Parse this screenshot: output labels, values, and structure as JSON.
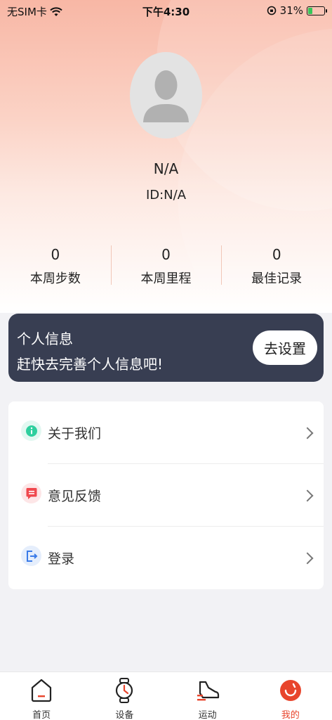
{
  "status_bar": {
    "carrier": "无SIM卡",
    "time": "下午4:30",
    "battery": "31%",
    "battery_level": 0.31
  },
  "profile": {
    "name": "N/A",
    "id": "ID:N/A"
  },
  "stats": [
    {
      "value": "0",
      "label": "本周步数"
    },
    {
      "value": "0",
      "label": "本周里程"
    },
    {
      "value": "0",
      "label": "最佳记录"
    }
  ],
  "promo": {
    "title": "个人信息",
    "subtitle": "赶快去完善个人信息吧!",
    "button": "去设置"
  },
  "menu": [
    {
      "label": "关于我们",
      "icon": "info-icon",
      "color": "#2ecf9e"
    },
    {
      "label": "意见反馈",
      "icon": "feedback-icon",
      "color": "#f0484e"
    },
    {
      "label": "登录",
      "icon": "login-icon",
      "color": "#3a7be8"
    }
  ],
  "tabs": [
    {
      "label": "首页",
      "icon": "home-icon",
      "active": false
    },
    {
      "label": "设备",
      "icon": "watch-icon",
      "active": false
    },
    {
      "label": "运动",
      "icon": "shoe-icon",
      "active": false
    },
    {
      "label": "我的",
      "icon": "profile-icon",
      "active": true
    }
  ],
  "colors": {
    "accent": "#e8452c",
    "card_dark": "#383e52",
    "background": "#f2f2f5"
  }
}
